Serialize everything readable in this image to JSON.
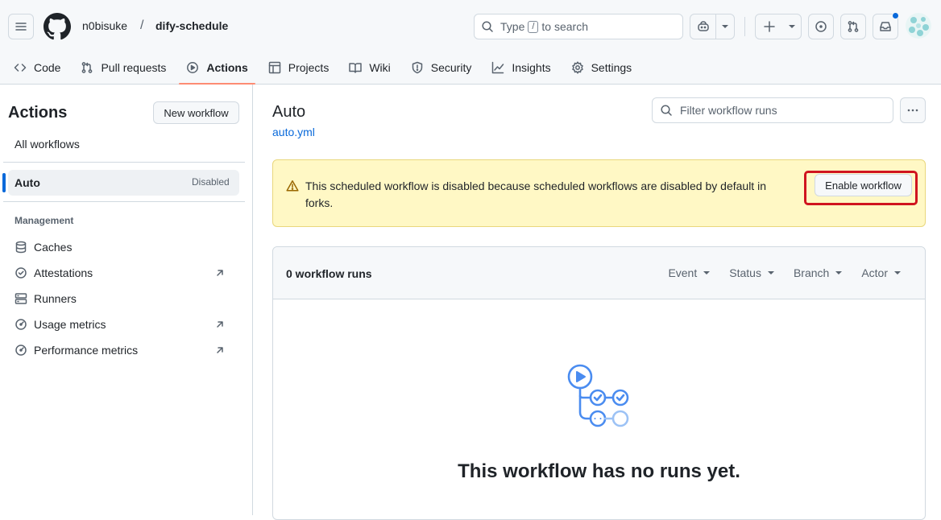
{
  "header": {
    "owner": "n0bisuke",
    "separator": "/",
    "repo": "dify-schedule",
    "search": {
      "prefix": "Type",
      "key": "/",
      "suffix": "to search"
    }
  },
  "nav": {
    "tabs": [
      {
        "label": "Code",
        "icon": "code-icon",
        "active": false
      },
      {
        "label": "Pull requests",
        "icon": "pull-request-icon",
        "active": false
      },
      {
        "label": "Actions",
        "icon": "play-icon",
        "active": true
      },
      {
        "label": "Projects",
        "icon": "table-icon",
        "active": false
      },
      {
        "label": "Wiki",
        "icon": "book-icon",
        "active": false
      },
      {
        "label": "Security",
        "icon": "shield-icon",
        "active": false
      },
      {
        "label": "Insights",
        "icon": "graph-icon",
        "active": false
      },
      {
        "label": "Settings",
        "icon": "gear-icon",
        "active": false
      }
    ]
  },
  "sidebar": {
    "title": "Actions",
    "new_workflow": "New workflow",
    "all_workflows": "All workflows",
    "selected": {
      "name": "Auto",
      "status": "Disabled"
    },
    "management_label": "Management",
    "management": [
      {
        "label": "Caches",
        "icon": "database-icon",
        "external": false
      },
      {
        "label": "Attestations",
        "icon": "verified-icon",
        "external": true
      },
      {
        "label": "Runners",
        "icon": "server-icon",
        "external": false
      },
      {
        "label": "Usage metrics",
        "icon": "meter-icon",
        "external": true
      },
      {
        "label": "Performance metrics",
        "icon": "meter-icon",
        "external": true
      }
    ]
  },
  "main": {
    "title": "Auto",
    "file": "auto.yml",
    "filter_placeholder": "Filter workflow runs",
    "flash": {
      "message": "This scheduled workflow is disabled because scheduled workflows are disabled by default in forks.",
      "button": "Enable workflow"
    },
    "runs": {
      "count_label": "0 workflow runs",
      "filters": [
        "Event",
        "Status",
        "Branch",
        "Actor"
      ]
    },
    "empty_title": "This workflow has no runs yet."
  },
  "colors": {
    "accent": "#0969da",
    "tab_underline": "#fd8c73",
    "flash_bg": "#fff8c5",
    "highlight": "#d0141f"
  }
}
